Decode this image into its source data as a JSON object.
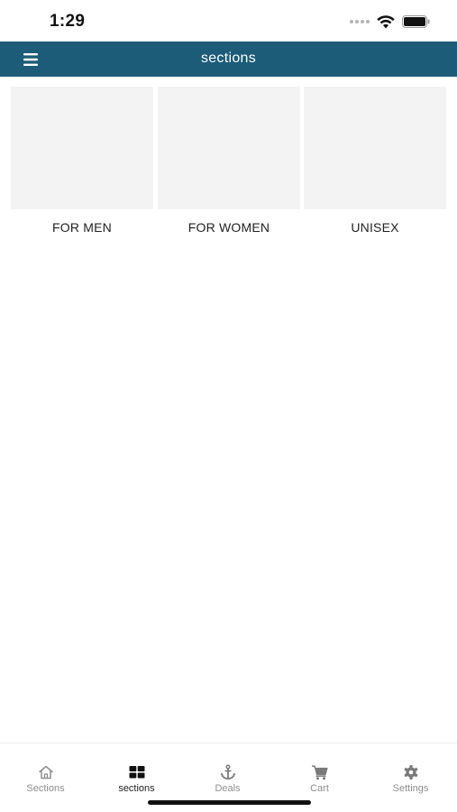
{
  "status_bar": {
    "time": "1:29"
  },
  "app_bar": {
    "title": "sections"
  },
  "sections": [
    {
      "label": "FOR MEN"
    },
    {
      "label": "FOR WOMEN"
    },
    {
      "label": "UNISEX"
    }
  ],
  "tabs": [
    {
      "label": "Sections",
      "icon": "home-icon",
      "active": false
    },
    {
      "label": "sections",
      "icon": "grid-icon",
      "active": true
    },
    {
      "label": "Deals",
      "icon": "anchor-icon",
      "active": false
    },
    {
      "label": "Cart",
      "icon": "cart-icon",
      "active": false
    },
    {
      "label": "Settings",
      "icon": "gear-icon",
      "active": false
    }
  ],
  "colors": {
    "app_bar": "#1c5c78",
    "card_placeholder": "#f3f3f3",
    "tab_inactive": "#8e8e8e",
    "tab_active": "#222222"
  }
}
